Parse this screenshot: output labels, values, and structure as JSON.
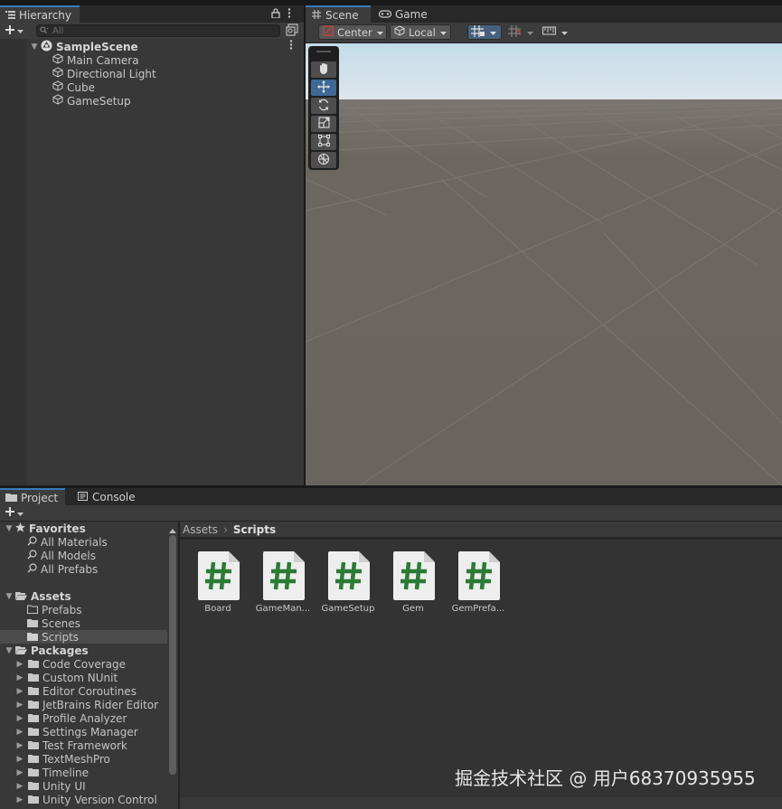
{
  "hierarchy": {
    "tab_label": "Hierarchy",
    "search_placeholder": "All",
    "scene_name": "SampleScene",
    "objects": [
      "Main Camera",
      "Directional Light",
      "Cube",
      "GameSetup"
    ]
  },
  "scene_view": {
    "tabs": [
      {
        "label": "Scene",
        "icon": "grid-icon",
        "active": true
      },
      {
        "label": "Game",
        "icon": "gamepad-icon",
        "active": false
      }
    ],
    "pivot_mode": "Center",
    "pivot_rotation": "Local",
    "tools": [
      "hand-tool",
      "move-tool",
      "rotate-tool",
      "scale-tool",
      "rect-tool",
      "transform-tool"
    ],
    "active_tool": "move-tool"
  },
  "project": {
    "tabs": [
      {
        "label": "Project",
        "icon": "folder-icon",
        "active": true
      },
      {
        "label": "Console",
        "icon": "console-icon",
        "active": false
      }
    ],
    "favorites": {
      "label": "Favorites",
      "items": [
        "All Materials",
        "All Models",
        "All Prefabs"
      ]
    },
    "assets": {
      "label": "Assets",
      "items": [
        "Prefabs",
        "Scenes",
        "Scripts"
      ],
      "selected": "Scripts"
    },
    "packages": {
      "label": "Packages",
      "items": [
        "Code Coverage",
        "Custom NUnit",
        "Editor Coroutines",
        "JetBrains Rider Editor",
        "Profile Analyzer",
        "Settings Manager",
        "Test Framework",
        "TextMeshPro",
        "Timeline",
        "Unity UI",
        "Unity Version Control"
      ]
    },
    "breadcrumb": [
      "Assets",
      "Scripts"
    ],
    "files": [
      "Board",
      "GameMan...",
      "GameSetup",
      "Gem",
      "GemPrefa..."
    ]
  },
  "watermark": "掘金技术社区 @ 用户68370935955",
  "colors": {
    "accent": "#3a79bb",
    "script_hash": "#2b7a35",
    "ground": "#6e6862",
    "sky": "#c3dcea"
  }
}
